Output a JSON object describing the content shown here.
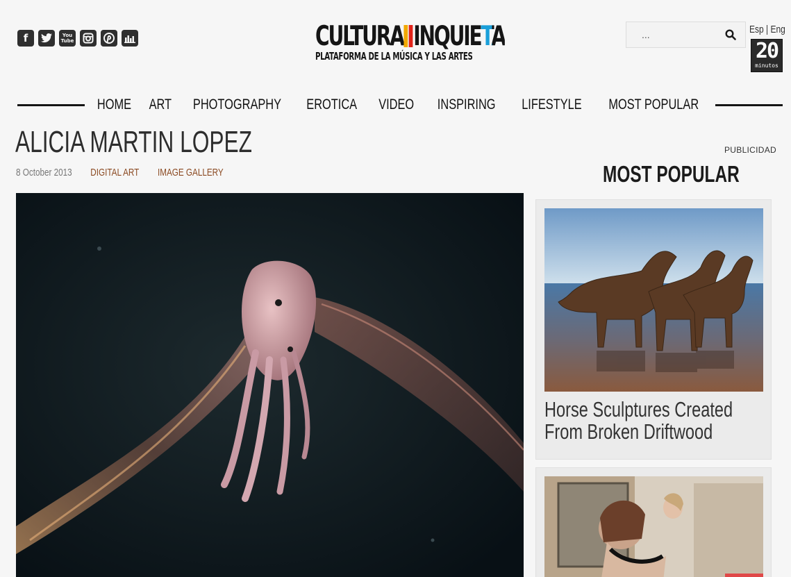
{
  "social": {
    "icons": [
      "facebook-icon",
      "twitter-icon",
      "youtube-icon",
      "instagram-icon",
      "pinterest-icon",
      "stats-icon"
    ],
    "youtube_label": "You Tube"
  },
  "logo": {
    "word1": "CULTURA",
    "word2": "INQUIETA",
    "tagline": "PLATAFORMA DE LA MÚSICA Y LAS ARTES",
    "bar_colors": [
      "#f2a900",
      "#e2231a",
      "#1a9fd9",
      "#3aa935"
    ]
  },
  "search": {
    "placeholder": "...",
    "icon": "search-icon"
  },
  "lang": {
    "esp": "Esp",
    "sep": "|",
    "eng": "Eng"
  },
  "partner": {
    "number": "20",
    "label": "minutos"
  },
  "nav": {
    "items": [
      "HOME",
      "ART",
      "PHOTOGRAPHY",
      "EROTICA",
      "VIDEO",
      "INSPIRING",
      "LIFESTYLE",
      "MOST POPULAR"
    ]
  },
  "article": {
    "title": "ALICIA MARTIN LOPEZ",
    "date": "8 October 2013",
    "categories": [
      "DIGITAL ART",
      "IMAGE GALLERY"
    ]
  },
  "sidebar": {
    "ad_label": "PUBLICIDAD",
    "heading": "MOST POPULAR",
    "cards": [
      {
        "title": "Horse Sculptures Created From Broken Driftwood"
      },
      {
        "title": ""
      }
    ]
  },
  "colors": {
    "accent_link": "#8b4a22",
    "background": "#f6f6f6",
    "text": "#222222"
  }
}
